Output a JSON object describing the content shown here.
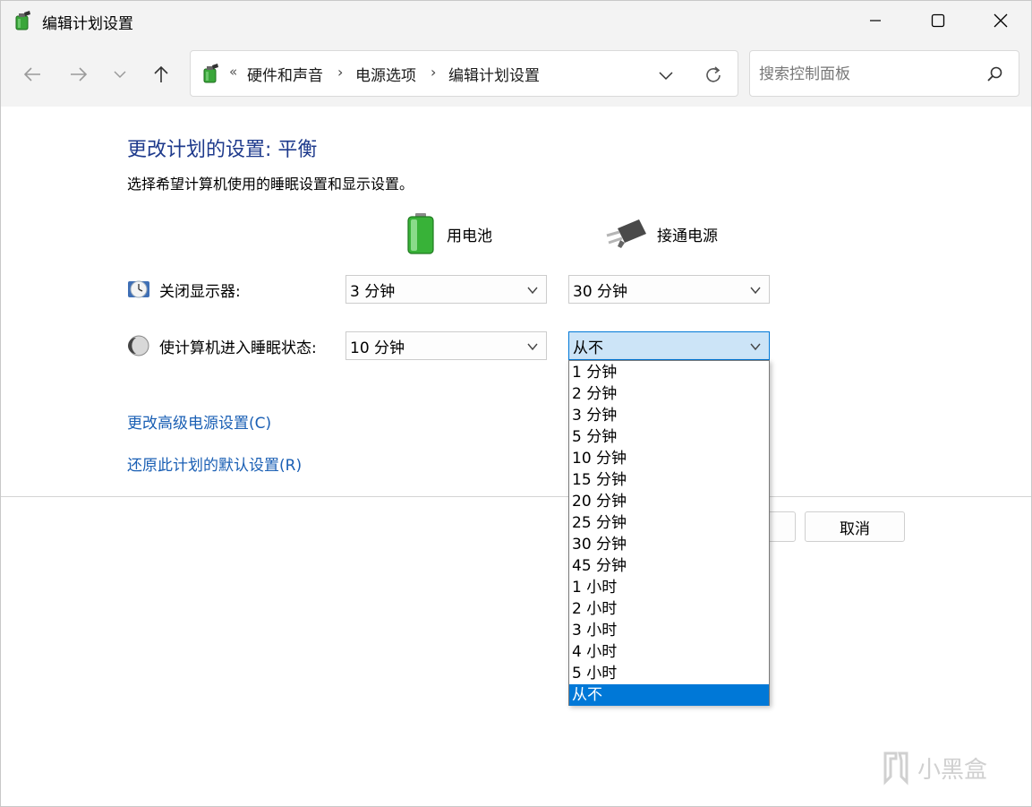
{
  "window": {
    "title": "编辑计划设置",
    "controls": {
      "minimize": "minimize",
      "maximize": "maximize",
      "close": "close"
    }
  },
  "nav": {
    "breadcrumb_prefix": "«",
    "breadcrumbs": [
      "硬件和声音",
      "电源选项",
      "编辑计划设置"
    ],
    "separator": "›",
    "search_placeholder": "搜索控制面板"
  },
  "main": {
    "heading": "更改计划的设置: 平衡",
    "subtitle": "选择希望计算机使用的睡眠设置和显示设置。",
    "columns": {
      "battery": "用电池",
      "plugged": "接通电源"
    },
    "rows": [
      {
        "label": "关闭显示器:",
        "battery": "3 分钟",
        "plugged": "30 分钟"
      },
      {
        "label": "使计算机进入睡眠状态:",
        "battery": "10 分钟",
        "plugged": "从不"
      }
    ],
    "links": {
      "advanced": "更改高级电源设置(C)",
      "restore": "还原此计划的默认设置(R)"
    },
    "buttons": {
      "cancel": "取消"
    }
  },
  "dropdown": {
    "options": [
      "1 分钟",
      "2 分钟",
      "3 分钟",
      "5 分钟",
      "10 分钟",
      "15 分钟",
      "20 分钟",
      "25 分钟",
      "30 分钟",
      "45 分钟",
      "1 小时",
      "2 小时",
      "3 小时",
      "4 小时",
      "5 小时",
      "从不"
    ],
    "selected": "从不"
  },
  "watermark": "小黑盒",
  "colors": {
    "accent": "#0078d7",
    "heading": "#1e3a8c",
    "link": "#1a5fb4",
    "selected_bg": "#cce4f7",
    "chrome_bg": "#f3f3f3"
  }
}
